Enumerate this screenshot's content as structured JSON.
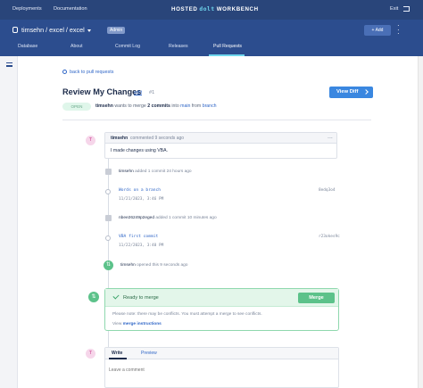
{
  "nav": {
    "deployments": "Deployments",
    "documentation": "Documentation",
    "brand_left": "HOSTED",
    "brand_mid": "dolt",
    "brand_right": "WORKBENCH",
    "exit": "Exit"
  },
  "repo": {
    "title": "timsehn / excel / excel",
    "badge": "Admin",
    "add": "+ Add",
    "tabs": [
      "Database",
      "About",
      "Commit Log",
      "Releases",
      "Pull Requests"
    ],
    "active_tab": "Pull Requests"
  },
  "pr": {
    "back": "back to pull requests",
    "title": "Review My Changes",
    "edit": "edit",
    "number": "#1",
    "view_diff": "View Diff",
    "state": "OPEN",
    "author": "timsehn",
    "summary_mid": " wants to merge ",
    "commit_count": "2 commits",
    "summary_into": " into ",
    "to_branch": "main",
    "summary_from": " from ",
    "from_branch": "branch"
  },
  "comment": {
    "avatar": "T",
    "author": "timsehn",
    "when": "commented 9 seconds ago",
    "more": "...",
    "body": "I made changes using VBA."
  },
  "timeline": {
    "event1": {
      "who": "timsehn",
      "text": " added 1 commit 24 hours ago"
    },
    "commit1": {
      "msg": "Words on a branch",
      "date": "11/21/2023, 3:46 PM",
      "hash": "8edq3o4"
    },
    "event2": {
      "who": "nbee26249p2eged",
      "text": " added 1 commit 10 minutes ago"
    },
    "commit2": {
      "msg": "VBA first commit",
      "date": "11/22/2023, 3:40 PM",
      "hash": "r23okes9c"
    },
    "opened": {
      "who": "timsehn",
      "text": " opened this 9 seconds ago"
    }
  },
  "merge": {
    "ready": "Ready to merge",
    "button": "Merge",
    "note": "Please note: there may be conflicts. You must attempt a merge to see conflicts.",
    "view": "View ",
    "instructions": "merge instructions"
  },
  "new_comment": {
    "avatar": "T",
    "tab_write": "Write",
    "tab_preview": "Preview",
    "placeholder": "Leave a comment"
  },
  "colors": {
    "nav_bg": "#29457a",
    "repo_bg": "#2c4d8e",
    "accent": "#3a87e0",
    "merge_green": "#5cc28a"
  }
}
